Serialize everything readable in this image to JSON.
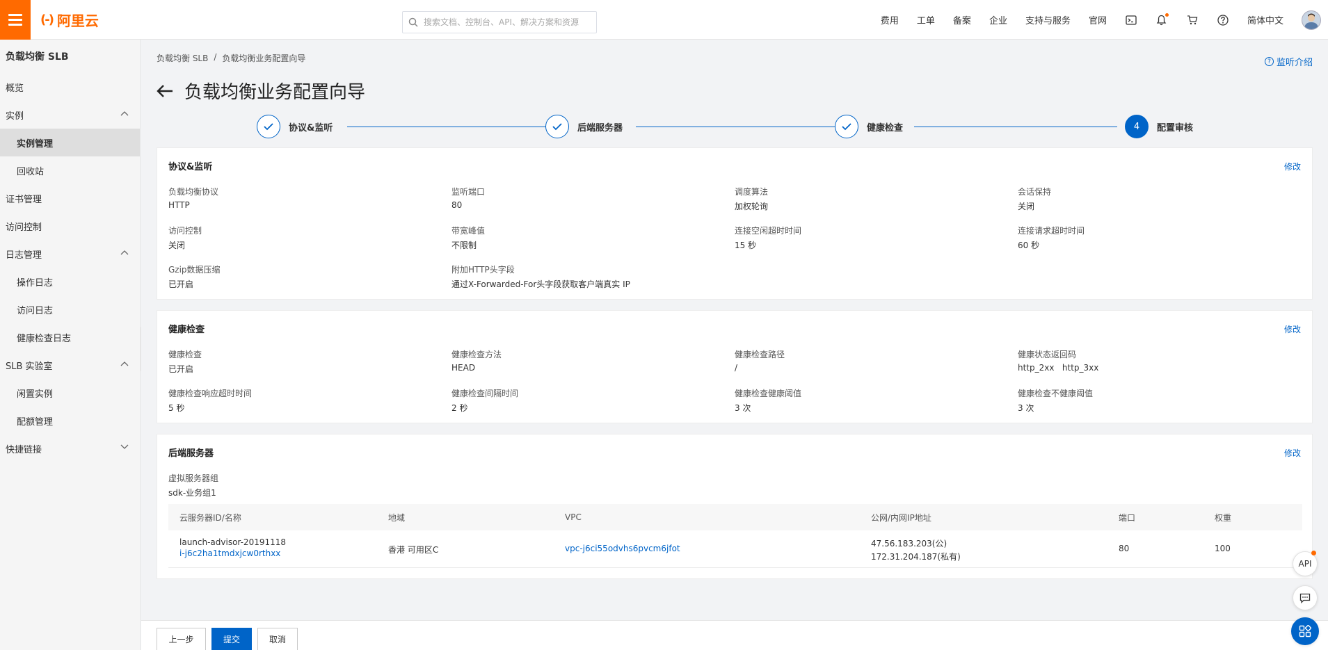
{
  "brand": {
    "name": "阿里云",
    "mark": "(-)",
    "color": "#ff6a00"
  },
  "search": {
    "placeholder": "搜索文档、控制台、API、解决方案和资源"
  },
  "topnav": {
    "items": [
      "费用",
      "工单",
      "备案",
      "企业",
      "支持与服务",
      "官网"
    ],
    "language": "简体中文",
    "icons": [
      "terminal-icon",
      "bell-icon",
      "cart-icon",
      "help-icon"
    ]
  },
  "sidebar": {
    "title": "负载均衡 SLB",
    "items": [
      {
        "label": "概览",
        "sub": false
      },
      {
        "label": "实例",
        "sub": false,
        "chevron": "up"
      },
      {
        "label": "实例管理",
        "sub": true,
        "active": true
      },
      {
        "label": "回收站",
        "sub": true
      },
      {
        "label": "证书管理",
        "sub": false
      },
      {
        "label": "访问控制",
        "sub": false
      },
      {
        "label": "日志管理",
        "sub": false,
        "chevron": "up"
      },
      {
        "label": "操作日志",
        "sub": true
      },
      {
        "label": "访问日志",
        "sub": true
      },
      {
        "label": "健康检查日志",
        "sub": true
      },
      {
        "label": "SLB 实验室",
        "sub": false,
        "chevron": "up"
      },
      {
        "label": "闲置实例",
        "sub": true
      },
      {
        "label": "配额管理",
        "sub": true
      },
      {
        "label": "快捷链接",
        "sub": false,
        "chevron": "down"
      }
    ]
  },
  "breadcrumb": {
    "root": "负载均衡 SLB",
    "sep": "/",
    "current": "负载均衡业务配置向导"
  },
  "help_link": "监听介绍",
  "page_title": "负载均衡业务配置向导",
  "steps": [
    {
      "label": "协议&监听",
      "done": true
    },
    {
      "label": "后端服务器",
      "done": true
    },
    {
      "label": "健康检查",
      "done": true
    },
    {
      "label": "配置审核",
      "done": false,
      "number": "4"
    }
  ],
  "edit_label": "修改",
  "sections": {
    "listener": {
      "title": "协议&监听",
      "fields": [
        {
          "label": "负载均衡协议",
          "value": "HTTP"
        },
        {
          "label": "监听端口",
          "value": "80"
        },
        {
          "label": "调度算法",
          "value": "加权轮询"
        },
        {
          "label": "会话保持",
          "value": "关闭"
        },
        {
          "label": "访问控制",
          "value": "关闭"
        },
        {
          "label": "带宽峰值",
          "value": "不限制"
        },
        {
          "label": "连接空闲超时时间",
          "value": "15 秒"
        },
        {
          "label": "连接请求超时时间",
          "value": "60 秒"
        },
        {
          "label": "Gzip数据压缩",
          "value": "已开启"
        },
        {
          "label": "附加HTTP头字段",
          "value": "通过X-Forwarded-For头字段获取客户端真实 IP"
        }
      ]
    },
    "health": {
      "title": "健康检查",
      "fields": [
        {
          "label": "健康检查",
          "value": "已开启"
        },
        {
          "label": "健康检查方法",
          "value": "HEAD"
        },
        {
          "label": "健康检查路径",
          "value": "/"
        },
        {
          "label": "健康状态返回码",
          "value": "http_2xx   http_3xx"
        },
        {
          "label": "健康检查响应超时时间",
          "value": "5 秒"
        },
        {
          "label": "健康检查间隔时间",
          "value": "2 秒"
        },
        {
          "label": "健康检查健康阈值",
          "value": "3 次"
        },
        {
          "label": "健康检查不健康阈值",
          "value": "3 次"
        }
      ]
    },
    "backend": {
      "title": "后端服务器",
      "group_label": "虚拟服务器组",
      "group_value": "sdk-业务组1",
      "columns": [
        "云服务器ID/名称",
        "地域",
        "VPC",
        "公网/内网IP地址",
        "端口",
        "权重"
      ],
      "rows": [
        {
          "name": "launch-advisor-20191118",
          "id": "i-j6c2ha1tmdxjcw0rthxx",
          "region": "香港 可用区C",
          "vpc": "vpc-j6ci55odvhs6pvcm6jfot",
          "public_ip": "47.56.183.203(公)",
          "private_ip": "172.31.204.187(私有)",
          "port": "80",
          "weight": "100"
        }
      ]
    }
  },
  "footer": {
    "prev": "上一步",
    "submit": "提交",
    "cancel": "取消"
  },
  "float": {
    "api": "API"
  },
  "colors": {
    "primary": "#0064c8",
    "accent": "#ff6a00"
  }
}
